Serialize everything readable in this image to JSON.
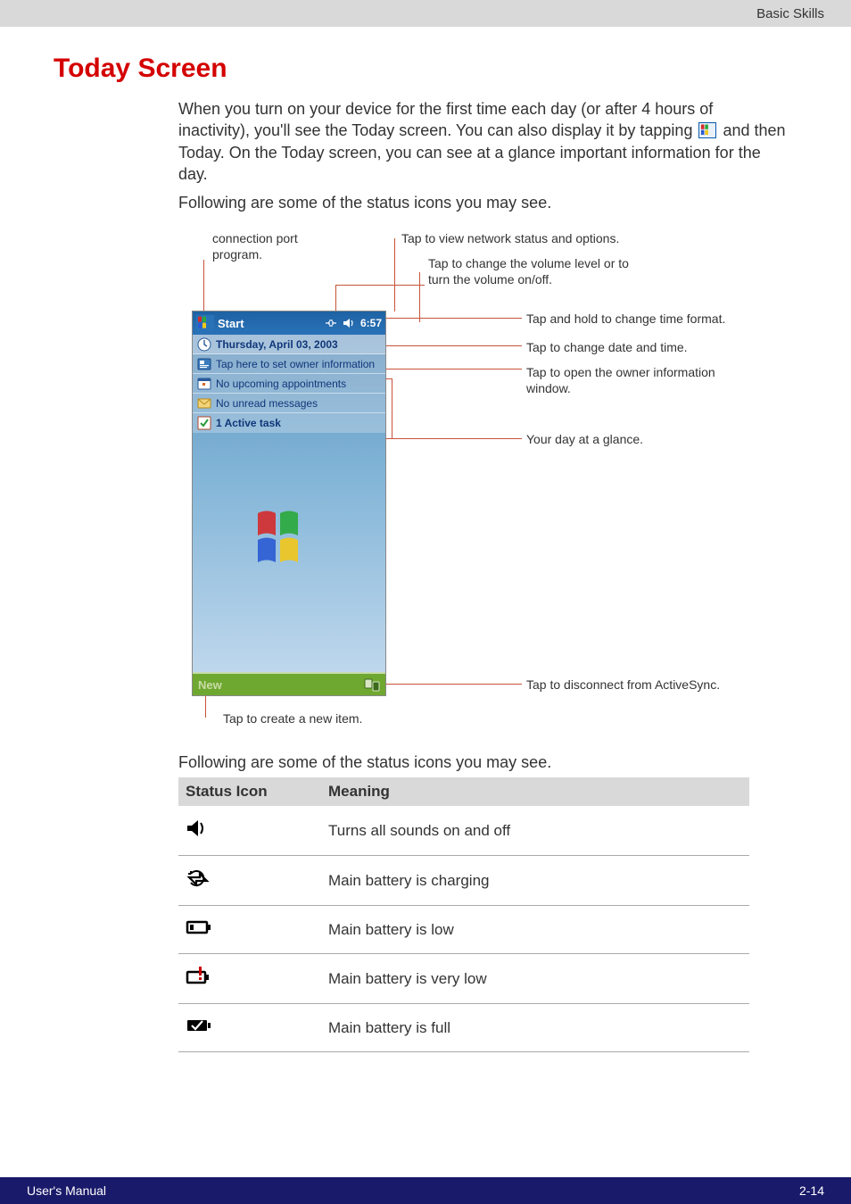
{
  "header": {
    "section": "Basic Skills"
  },
  "title": "Today Screen",
  "para1_a": "When you turn on your device for the first time each day (or after 4 hours of inactivity), you'll see the Today screen. You can also display it by tapping ",
  "para1_b": " and then Today. On the Today screen, you can see at a glance important information for the day.",
  "para2": "Following are some of the status icons you may see.",
  "diagram": {
    "conn_port": "connection port program.",
    "net_status": "Tap to view network status and options.",
    "volume": "Tap to change the volume level or to turn the volume on/off.",
    "time_format": "Tap and hold to change time format.",
    "date_time": "Tap to change date and time.",
    "owner_info": "Tap to open the owner information window.",
    "day_glance": "Your day at a glance.",
    "activesync": "Tap to disconnect from ActiveSync.",
    "new_item": "Tap to create a new item."
  },
  "device": {
    "start": "Start",
    "time": "6:57",
    "date": "Thursday, April 03, 2003",
    "owner": "Tap here to set owner information",
    "appointments": "No upcoming appointments",
    "messages": "No unread messages",
    "tasks": "1 Active task",
    "new": "New"
  },
  "table_intro": "Following are some of the status icons you may see.",
  "table": {
    "col1": "Status Icon",
    "col2": "Meaning",
    "rows": [
      {
        "icon": "speaker",
        "meaning": "Turns all sounds on and off"
      },
      {
        "icon": "battery-charging",
        "meaning": "Main battery is charging"
      },
      {
        "icon": "battery-low",
        "meaning": "Main battery is low"
      },
      {
        "icon": "battery-very-low",
        "meaning": "Main battery is very low"
      },
      {
        "icon": "battery-full",
        "meaning": "Main battery is full"
      }
    ]
  },
  "footer": {
    "left": "User's Manual",
    "right": "2-14"
  }
}
